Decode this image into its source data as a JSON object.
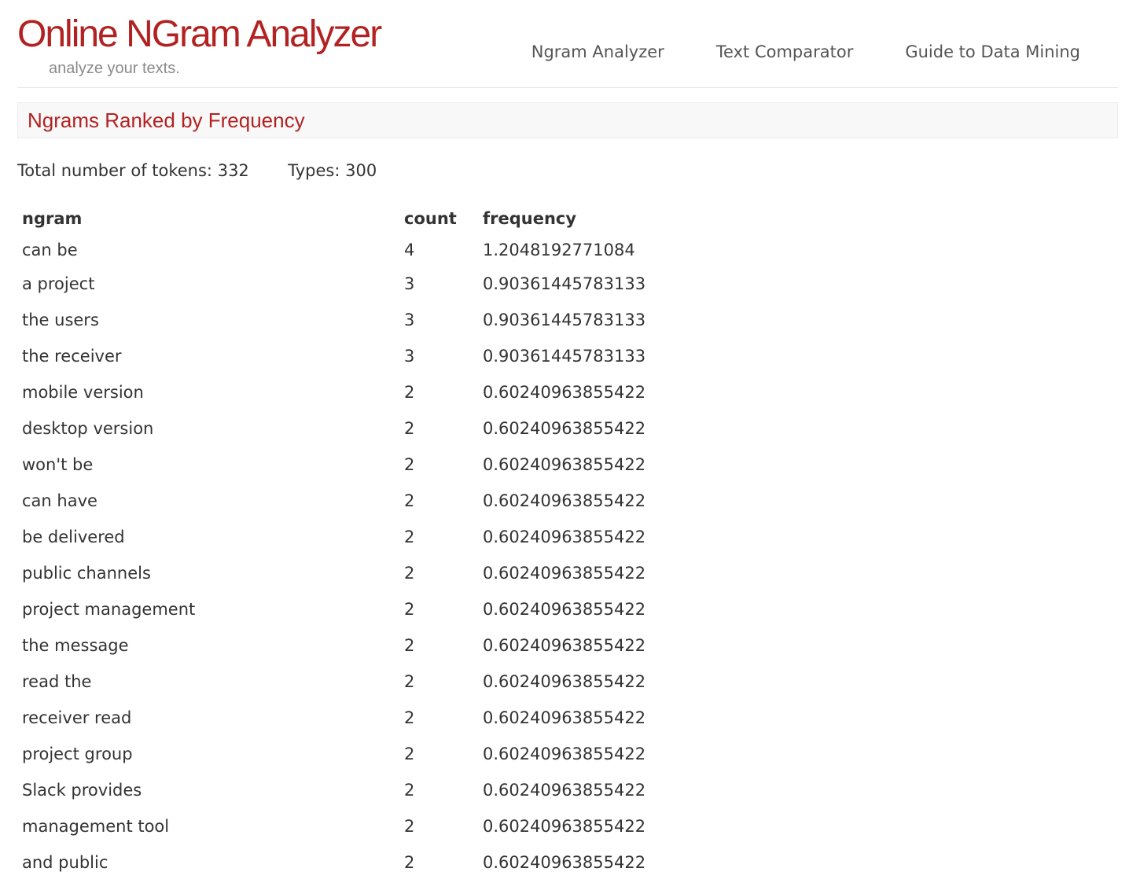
{
  "header": {
    "logo_title": "Online NGram Analyzer",
    "logo_tagline": "analyze your texts.",
    "nav": [
      {
        "label": "Ngram Analyzer"
      },
      {
        "label": "Text Comparator"
      },
      {
        "label": "Guide to Data Mining"
      }
    ]
  },
  "section": {
    "title": "Ngrams Ranked by Frequency"
  },
  "stats": {
    "tokens_label": "Total number of tokens:",
    "tokens_value": "332",
    "types_label": "Types:",
    "types_value": "300"
  },
  "table": {
    "columns": [
      "ngram",
      "count",
      "frequency"
    ],
    "rows": [
      {
        "ngram": "can be",
        "count": "4",
        "frequency": "1.2048192771084"
      },
      {
        "ngram": "a project",
        "count": "3",
        "frequency": "0.90361445783133"
      },
      {
        "ngram": "the users",
        "count": "3",
        "frequency": "0.90361445783133"
      },
      {
        "ngram": "the receiver",
        "count": "3",
        "frequency": "0.90361445783133"
      },
      {
        "ngram": "mobile version",
        "count": "2",
        "frequency": "0.60240963855422"
      },
      {
        "ngram": "desktop version",
        "count": "2",
        "frequency": "0.60240963855422"
      },
      {
        "ngram": "won't be",
        "count": "2",
        "frequency": "0.60240963855422"
      },
      {
        "ngram": "can have",
        "count": "2",
        "frequency": "0.60240963855422"
      },
      {
        "ngram": "be delivered",
        "count": "2",
        "frequency": "0.60240963855422"
      },
      {
        "ngram": "public channels",
        "count": "2",
        "frequency": "0.60240963855422"
      },
      {
        "ngram": "project management",
        "count": "2",
        "frequency": "0.60240963855422"
      },
      {
        "ngram": "the message",
        "count": "2",
        "frequency": "0.60240963855422"
      },
      {
        "ngram": "read the",
        "count": "2",
        "frequency": "0.60240963855422"
      },
      {
        "ngram": "receiver read",
        "count": "2",
        "frequency": "0.60240963855422"
      },
      {
        "ngram": "project group",
        "count": "2",
        "frequency": "0.60240963855422"
      },
      {
        "ngram": "Slack provides",
        "count": "2",
        "frequency": "0.60240963855422"
      },
      {
        "ngram": "management tool",
        "count": "2",
        "frequency": "0.60240963855422"
      },
      {
        "ngram": "and public",
        "count": "2",
        "frequency": "0.60240963855422"
      }
    ]
  },
  "colors": {
    "brand_red": "#b22222",
    "text": "#333333",
    "nav_text": "#555555",
    "tagline": "#8a8a8a"
  }
}
